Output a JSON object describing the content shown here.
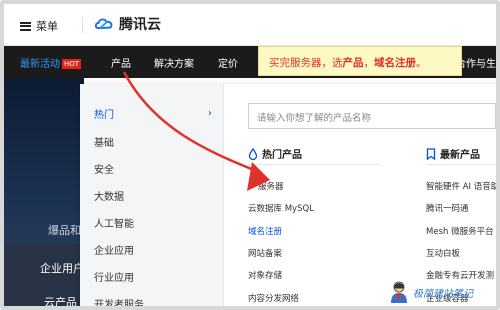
{
  "header": {
    "menu_label": "菜单",
    "brand": "腾讯云"
  },
  "nav": {
    "items": [
      {
        "label": "最新活动",
        "badge": "HOT"
      },
      {
        "label": "产品"
      },
      {
        "label": "解决方案"
      },
      {
        "label": "定价"
      },
      {
        "label": "合作与生"
      }
    ]
  },
  "banner": {
    "prefix": "买完服务器，选",
    "strong1": "产品",
    "middle": "，",
    "strong2": "域名注册",
    "suffix": "。"
  },
  "hero": {
    "text": "爆品和",
    "link1": "企业用户",
    "link2": "云产品"
  },
  "categories": [
    {
      "label": "热门",
      "active": true
    },
    {
      "label": "基础"
    },
    {
      "label": "安全"
    },
    {
      "label": "大数据"
    },
    {
      "label": "人工智能"
    },
    {
      "label": "企业应用"
    },
    {
      "label": "行业应用"
    },
    {
      "label": "开发者服务"
    }
  ],
  "search": {
    "placeholder": "请输入你想了解的产品名称"
  },
  "hot_products": {
    "title": "热门产品",
    "items": [
      "服务器",
      "云数据库 MySQL",
      "域名注册",
      "网站备案",
      "对象存储",
      "内容分发网络"
    ]
  },
  "new_products": {
    "title": "最新产品",
    "items": [
      "智能硬件 AI 语音助",
      "腾讯一码通",
      "Mesh 微服务平台",
      "互动白板",
      "金融专有云开发测",
      "企业级容器"
    ]
  },
  "watermark": {
    "text": "极简建站笔记"
  },
  "colors": {
    "accent": "#0052d9",
    "nav_bg": "#1b1b1b",
    "hot_red": "#e2231a",
    "banner_bg": "#fdf9c4",
    "annotation_red": "#e0312b"
  }
}
